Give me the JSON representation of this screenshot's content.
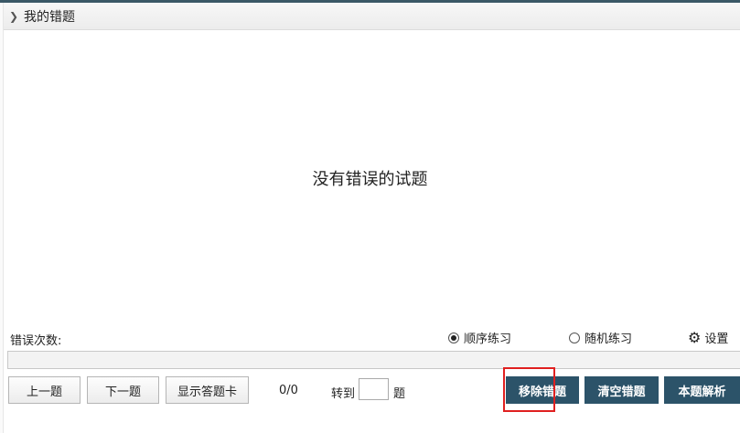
{
  "header": {
    "title": "我的错题"
  },
  "main": {
    "empty_message": "没有错误的试题"
  },
  "options": {
    "error_count_label": "错误次数:",
    "sequential_label": "顺序练习",
    "sequential_selected": true,
    "random_label": "随机练习",
    "random_selected": false,
    "settings_label": "设置"
  },
  "progress": {
    "value": 0
  },
  "toolbar": {
    "prev_label": "上一题",
    "next_label": "下一题",
    "answer_card_label": "显示答题卡",
    "counter": "0/0",
    "goto_label": "转到",
    "goto_value": "",
    "goto_unit": "题",
    "remove_label": "移除错题",
    "clear_label": "清空错题",
    "explain_label": "本题解析"
  },
  "colors": {
    "primary_button": "#2c5369",
    "highlight": "#e02020"
  }
}
